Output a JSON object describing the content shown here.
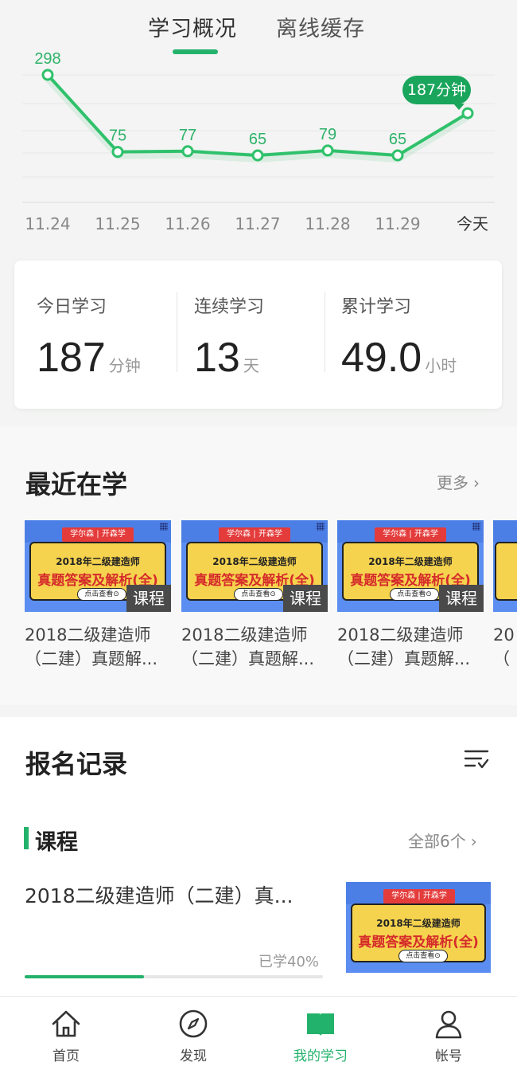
{
  "tabs": [
    {
      "label": "学习概况",
      "active": true
    },
    {
      "label": "离线缓存",
      "active": false
    }
  ],
  "chart_data": {
    "type": "line",
    "categories": [
      "11.24",
      "11.25",
      "11.26",
      "11.27",
      "11.28",
      "11.29",
      "今天"
    ],
    "values": [
      298,
      75,
      77,
      65,
      79,
      65,
      187
    ],
    "point_labels": [
      "298",
      "75",
      "77",
      "65",
      "79",
      "65",
      ""
    ],
    "highlight_label": "187分钟",
    "line_color": "#2fc16b",
    "grid": true
  },
  "stats": [
    {
      "label": "今日学习",
      "value": "187",
      "unit": "分钟"
    },
    {
      "label": "连续学习",
      "value": "13",
      "unit": "天"
    },
    {
      "label": "累计学习",
      "value": "49.0",
      "unit": "小时"
    }
  ],
  "recent": {
    "title": "最近在学",
    "more": "更多",
    "thumb": {
      "ribbon": "学尔森 | 开森学",
      "line1": "2018年二级建造师",
      "line2": "真题答案及解析(全)",
      "button": "点击查看⊙",
      "tag": "课程"
    },
    "courses": [
      {
        "title_line1": "2018二级建造师",
        "title_line2": "（二建）真题解..."
      },
      {
        "title_line1": "2018二级建造师",
        "title_line2": "（二建）真题解..."
      },
      {
        "title_line1": "2018二级建造师",
        "title_line2": "（二建）真题解..."
      },
      {
        "title_line1": "20",
        "title_line2": "（"
      }
    ]
  },
  "enroll": {
    "title": "报名记录",
    "filter_icon": "filter-icon",
    "category": "课程",
    "all_count": "全部6个",
    "item_title": "2018二级建造师（二建）真...",
    "progress_text": "已学40%",
    "progress": 0.4
  },
  "nav": [
    {
      "label": "首页",
      "icon": "home-icon",
      "active": false
    },
    {
      "label": "发现",
      "icon": "compass-icon",
      "active": false
    },
    {
      "label": "我的学习",
      "icon": "book-icon",
      "active": true
    },
    {
      "label": "帐号",
      "icon": "user-icon",
      "active": false
    }
  ],
  "colors": {
    "accent": "#23b26b",
    "badge": "#1aa55c"
  }
}
